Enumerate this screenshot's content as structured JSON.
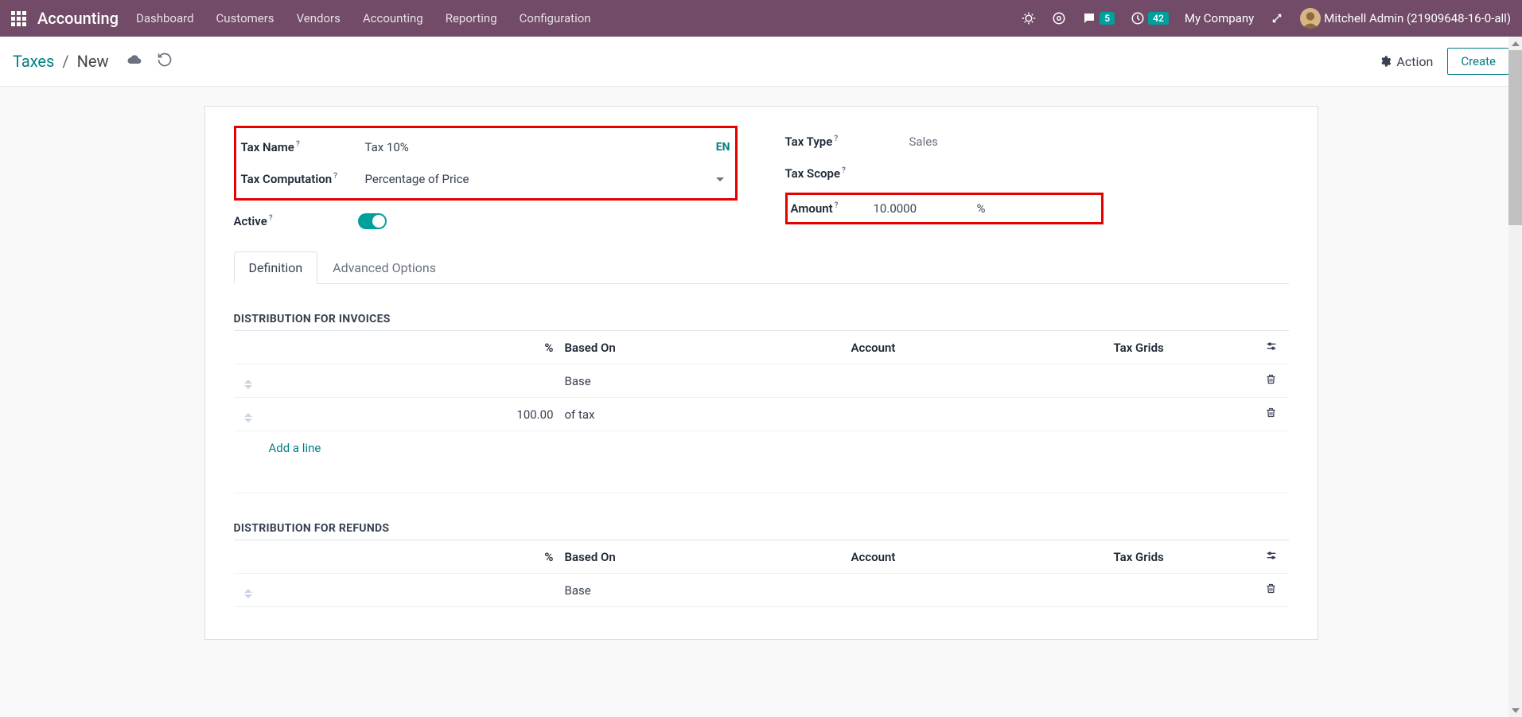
{
  "navbar": {
    "brand": "Accounting",
    "links": [
      "Dashboard",
      "Customers",
      "Vendors",
      "Accounting",
      "Reporting",
      "Configuration"
    ],
    "messages_badge": "5",
    "activities_badge": "42",
    "company": "My Company",
    "username": "Mitchell Admin (21909648-16-0-all)"
  },
  "breadcrumb": {
    "root": "Taxes",
    "current": "New",
    "action_label": "Action",
    "create_label": "Create"
  },
  "form": {
    "tax_name_label": "Tax Name",
    "tax_name_value": "Tax 10%",
    "lang_badge": "EN",
    "tax_computation_label": "Tax Computation",
    "tax_computation_value": "Percentage of Price",
    "active_label": "Active",
    "tax_type_label": "Tax Type",
    "tax_type_value": "Sales",
    "tax_scope_label": "Tax Scope",
    "amount_label": "Amount",
    "amount_value": "10.0000",
    "amount_unit": "%"
  },
  "tabs": {
    "definition": "Definition",
    "advanced": "Advanced Options"
  },
  "dist_invoices": {
    "title": "DISTRIBUTION FOR INVOICES",
    "head_pct": "%",
    "head_based": "Based On",
    "head_account": "Account",
    "head_grids": "Tax Grids",
    "rows": [
      {
        "pct": "",
        "based": "Base"
      },
      {
        "pct": "100.00",
        "based": "of tax"
      }
    ],
    "add_line": "Add a line"
  },
  "dist_refunds": {
    "title": "DISTRIBUTION FOR REFUNDS",
    "head_pct": "%",
    "head_based": "Based On",
    "head_account": "Account",
    "head_grids": "Tax Grids",
    "rows": [
      {
        "pct": "",
        "based": "Base"
      }
    ]
  }
}
